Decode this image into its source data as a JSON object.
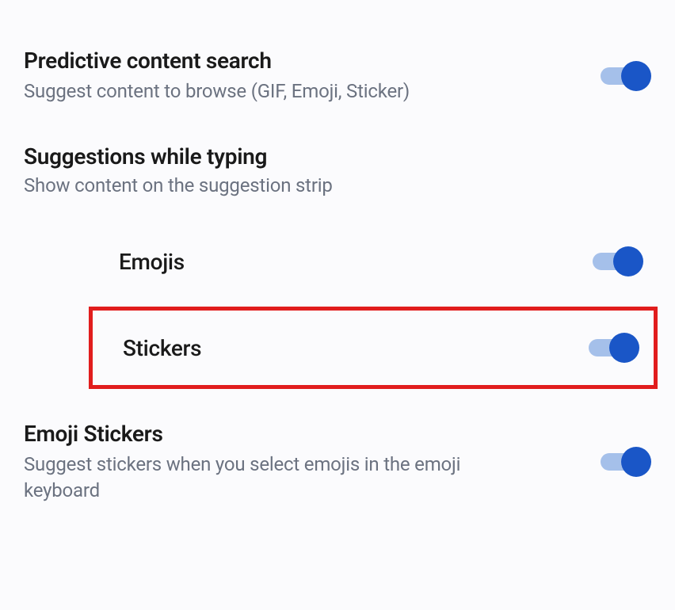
{
  "predictive": {
    "title": "Predictive content search",
    "subtitle": "Suggest content to browse (GIF, Emoji, Sticker)",
    "enabled": true
  },
  "suggestions": {
    "title": "Suggestions while typing",
    "subtitle": "Show content on the suggestion strip",
    "items": [
      {
        "label": "Emojis",
        "enabled": true
      },
      {
        "label": "Stickers",
        "enabled": true
      }
    ]
  },
  "emojiStickers": {
    "title": "Emoji Stickers",
    "subtitle": "Suggest stickers when you select emojis in the emoji keyboard",
    "enabled": true
  }
}
